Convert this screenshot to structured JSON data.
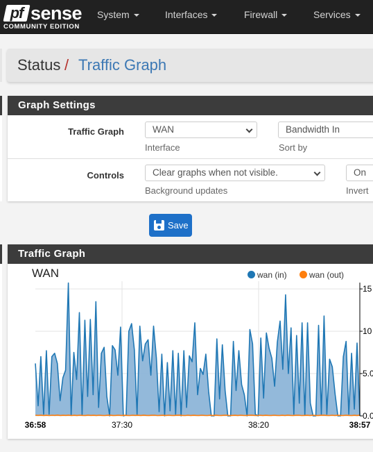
{
  "navbar": {
    "logo": {
      "mark": "pf",
      "word": "sense",
      "subtitle": "COMMUNITY EDITION"
    },
    "items": [
      {
        "label": "System"
      },
      {
        "label": "Interfaces"
      },
      {
        "label": "Firewall"
      },
      {
        "label": "Services"
      }
    ]
  },
  "breadcrumb": {
    "parent": "Status",
    "separator": "/",
    "current": "Traffic Graph"
  },
  "settings_panel": {
    "title": "Graph Settings",
    "rows": [
      {
        "label": "Traffic Graph",
        "fields": [
          {
            "value": "WAN",
            "help": "Interface"
          },
          {
            "value": "Bandwidth In",
            "help": "Sort by"
          }
        ]
      },
      {
        "label": "Controls",
        "fields": [
          {
            "value": "Clear graphs when not visible.",
            "help": "Background updates"
          },
          {
            "value": "On",
            "help": "Invert"
          }
        ]
      }
    ],
    "save_label": "Save"
  },
  "graph_panel": {
    "title": "Traffic Graph"
  },
  "colors": {
    "navbar_bg": "#212121",
    "panel_head_bg": "#3c3c3c",
    "link_blue": "#3c78b4",
    "separator_red": "#b5312c",
    "save_blue": "#1e70c8",
    "wan_in": "#1f77b4",
    "wan_out": "#ff7f0e"
  },
  "chart_data": {
    "type": "area",
    "title": "WAN",
    "legend": [
      {
        "name": "wan (in)",
        "color": "#1f77b4"
      },
      {
        "name": "wan (out)",
        "color": "#ff7f0e"
      }
    ],
    "legend_position": "top-right",
    "x_ticks": [
      "36:58",
      "37:30",
      "38:20",
      "38:57"
    ],
    "y_ticks": [
      "0.0",
      "5.0",
      "10",
      "15"
    ],
    "y_tick_labels_truncated": true,
    "ylim": [
      0,
      15.5
    ],
    "grid": true,
    "series": [
      {
        "name": "wan (in)",
        "values": [
          6.2,
          1.2,
          7.0,
          0.2,
          7.7,
          0.2,
          7.0,
          7.4,
          6.2,
          1.8,
          4.5,
          5.4,
          15.7,
          0.1,
          7.5,
          4.3,
          12.2,
          0.1,
          11.3,
          2.3,
          11.4,
          2.5,
          13.5,
          1.0,
          7.4,
          8.1,
          2.3,
          0.0,
          8.3,
          7.8,
          4.8,
          10.5,
          0.0,
          0.1,
          10.0,
          10.9,
          7.8,
          0.2,
          10.6,
          6.5,
          8.5,
          9.0,
          4.8,
          10.6,
          6.9,
          0.5,
          7.3,
          0.0,
          6.3,
          0.6,
          7.7,
          0.2,
          7.4,
          0.0,
          7.7,
          1.0,
          7.1,
          6.4,
          11.0,
          2.5,
          5.6,
          4.9,
          7.3,
          2.9,
          0.0,
          0.0,
          9.1,
          2.0,
          8.4,
          3.0,
          0.0,
          0.0,
          8.8,
          3.0,
          7.7,
          3.7,
          2.5,
          0.0,
          10.2,
          8.5,
          0.2,
          0.0,
          9.2,
          2.1,
          9.8,
          8.0,
          6.8,
          3.5,
          8.7,
          11.2,
          5.5,
          14.3,
          5.0,
          10.4,
          0.2,
          9.5,
          1.5,
          11.0,
          0.1,
          11.0,
          1.5,
          0.0,
          0.0,
          10.7,
          0.2,
          11.8,
          0.2,
          6.7,
          5.8,
          2.6,
          0.0,
          0.0,
          7.0,
          8.8,
          0.2,
          7.4,
          0.8,
          8.6,
          0.0
        ],
        "color": "#1f77b4"
      },
      {
        "name": "wan (out)",
        "values": [
          0.08,
          0.06,
          0.09,
          0.05,
          0.07,
          0.04,
          0.08,
          0.06,
          0.1,
          0.05,
          0.07,
          0.06,
          0.09,
          0.04,
          0.07,
          0.05,
          0.08,
          0.06,
          0.05,
          0.09,
          0.06,
          0.07,
          0.05,
          0.08,
          0.06,
          0.04,
          0.07,
          0.09,
          0.05,
          0.06,
          0.08,
          0.05,
          0.07,
          0.06,
          0.04,
          0.08,
          0.06,
          0.07,
          0.05,
          0.09,
          0.06,
          0.05,
          0.07,
          0.08,
          0.04,
          0.06,
          0.07,
          0.05,
          0.08,
          0.06,
          0.05,
          0.07,
          0.09,
          0.06,
          0.04,
          0.08,
          0.05,
          0.07,
          0.06,
          0.05,
          0.08,
          0.06,
          0.04,
          0.07,
          0.05,
          0.09,
          0.06,
          0.05,
          0.07,
          0.08,
          0.04,
          0.06,
          0.07,
          0.05,
          0.08,
          0.06,
          0.05,
          0.07,
          0.09,
          0.06,
          0.04,
          0.08,
          0.05,
          0.07,
          0.06,
          0.05,
          0.08,
          0.06,
          0.04,
          0.07,
          0.05,
          0.09,
          0.06,
          0.05,
          0.07,
          0.08,
          0.04,
          0.06,
          0.07,
          0.05,
          0.08,
          0.06,
          0.05,
          0.07,
          0.09,
          0.06,
          0.04,
          0.08,
          0.05,
          0.07,
          0.06,
          0.05,
          0.08,
          0.06,
          0.04,
          0.07,
          0.05,
          0.09
        ],
        "color": "#ff7f0e"
      }
    ]
  }
}
